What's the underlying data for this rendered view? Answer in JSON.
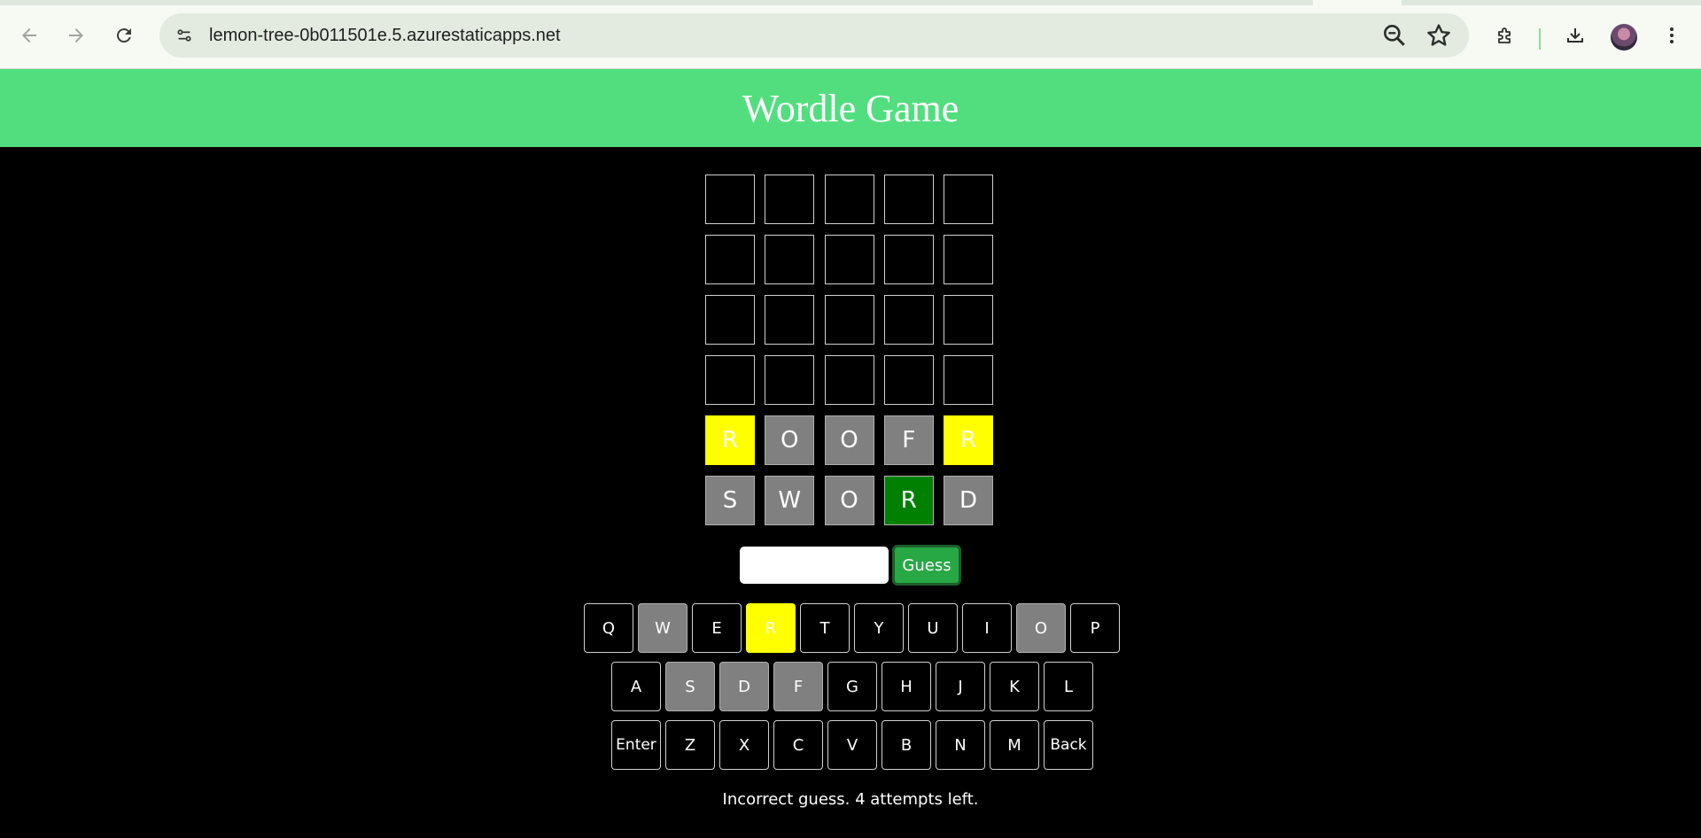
{
  "browser": {
    "url": "lemon-tree-0b011501e.5.azurestaticapps.net",
    "icons": [
      "back-arrow-icon",
      "forward-arrow-icon",
      "reload-icon",
      "site-info-icon",
      "zoom-icon",
      "bookmark-star-icon",
      "extensions-icon",
      "downloads-icon",
      "profile-avatar",
      "more-menu-icon"
    ],
    "accent_color": "#52de7f"
  },
  "header": {
    "title": "Wordle Game",
    "background": "#52de7f"
  },
  "board": {
    "rows": [
      [
        {
          "letter": "",
          "state": "empty"
        },
        {
          "letter": "",
          "state": "empty"
        },
        {
          "letter": "",
          "state": "empty"
        },
        {
          "letter": "",
          "state": "empty"
        },
        {
          "letter": "",
          "state": "empty"
        }
      ],
      [
        {
          "letter": "",
          "state": "empty"
        },
        {
          "letter": "",
          "state": "empty"
        },
        {
          "letter": "",
          "state": "empty"
        },
        {
          "letter": "",
          "state": "empty"
        },
        {
          "letter": "",
          "state": "empty"
        }
      ],
      [
        {
          "letter": "",
          "state": "empty"
        },
        {
          "letter": "",
          "state": "empty"
        },
        {
          "letter": "",
          "state": "empty"
        },
        {
          "letter": "",
          "state": "empty"
        },
        {
          "letter": "",
          "state": "empty"
        }
      ],
      [
        {
          "letter": "",
          "state": "empty"
        },
        {
          "letter": "",
          "state": "empty"
        },
        {
          "letter": "",
          "state": "empty"
        },
        {
          "letter": "",
          "state": "empty"
        },
        {
          "letter": "",
          "state": "empty"
        }
      ],
      [
        {
          "letter": "R",
          "state": "present"
        },
        {
          "letter": "O",
          "state": "absent"
        },
        {
          "letter": "O",
          "state": "absent"
        },
        {
          "letter": "F",
          "state": "absent"
        },
        {
          "letter": "R",
          "state": "present"
        }
      ],
      [
        {
          "letter": "S",
          "state": "absent"
        },
        {
          "letter": "W",
          "state": "absent"
        },
        {
          "letter": "O",
          "state": "absent"
        },
        {
          "letter": "R",
          "state": "correct"
        },
        {
          "letter": "D",
          "state": "absent"
        }
      ]
    ],
    "colors": {
      "present": "#ffff00",
      "absent": "#808080",
      "correct": "#008000",
      "empty": "#000000"
    }
  },
  "guess": {
    "input_value": "",
    "button_label": "Guess",
    "button_color": "#28a745"
  },
  "keyboard": {
    "rows": [
      [
        {
          "label": "Q",
          "state": "unused"
        },
        {
          "label": "W",
          "state": "absent"
        },
        {
          "label": "E",
          "state": "unused"
        },
        {
          "label": "R",
          "state": "present"
        },
        {
          "label": "T",
          "state": "unused"
        },
        {
          "label": "Y",
          "state": "unused"
        },
        {
          "label": "U",
          "state": "unused"
        },
        {
          "label": "I",
          "state": "unused"
        },
        {
          "label": "O",
          "state": "absent"
        },
        {
          "label": "P",
          "state": "unused"
        }
      ],
      [
        {
          "label": "A",
          "state": "unused"
        },
        {
          "label": "S",
          "state": "absent"
        },
        {
          "label": "D",
          "state": "absent"
        },
        {
          "label": "F",
          "state": "absent"
        },
        {
          "label": "G",
          "state": "unused"
        },
        {
          "label": "H",
          "state": "unused"
        },
        {
          "label": "J",
          "state": "unused"
        },
        {
          "label": "K",
          "state": "unused"
        },
        {
          "label": "L",
          "state": "unused"
        }
      ],
      [
        {
          "label": "Enter",
          "state": "unused"
        },
        {
          "label": "Z",
          "state": "unused"
        },
        {
          "label": "X",
          "state": "unused"
        },
        {
          "label": "C",
          "state": "unused"
        },
        {
          "label": "V",
          "state": "unused"
        },
        {
          "label": "B",
          "state": "unused"
        },
        {
          "label": "N",
          "state": "unused"
        },
        {
          "label": "M",
          "state": "unused"
        },
        {
          "label": "Back",
          "state": "unused"
        }
      ]
    ]
  },
  "status": {
    "message": "Incorrect guess. 4 attempts left."
  }
}
